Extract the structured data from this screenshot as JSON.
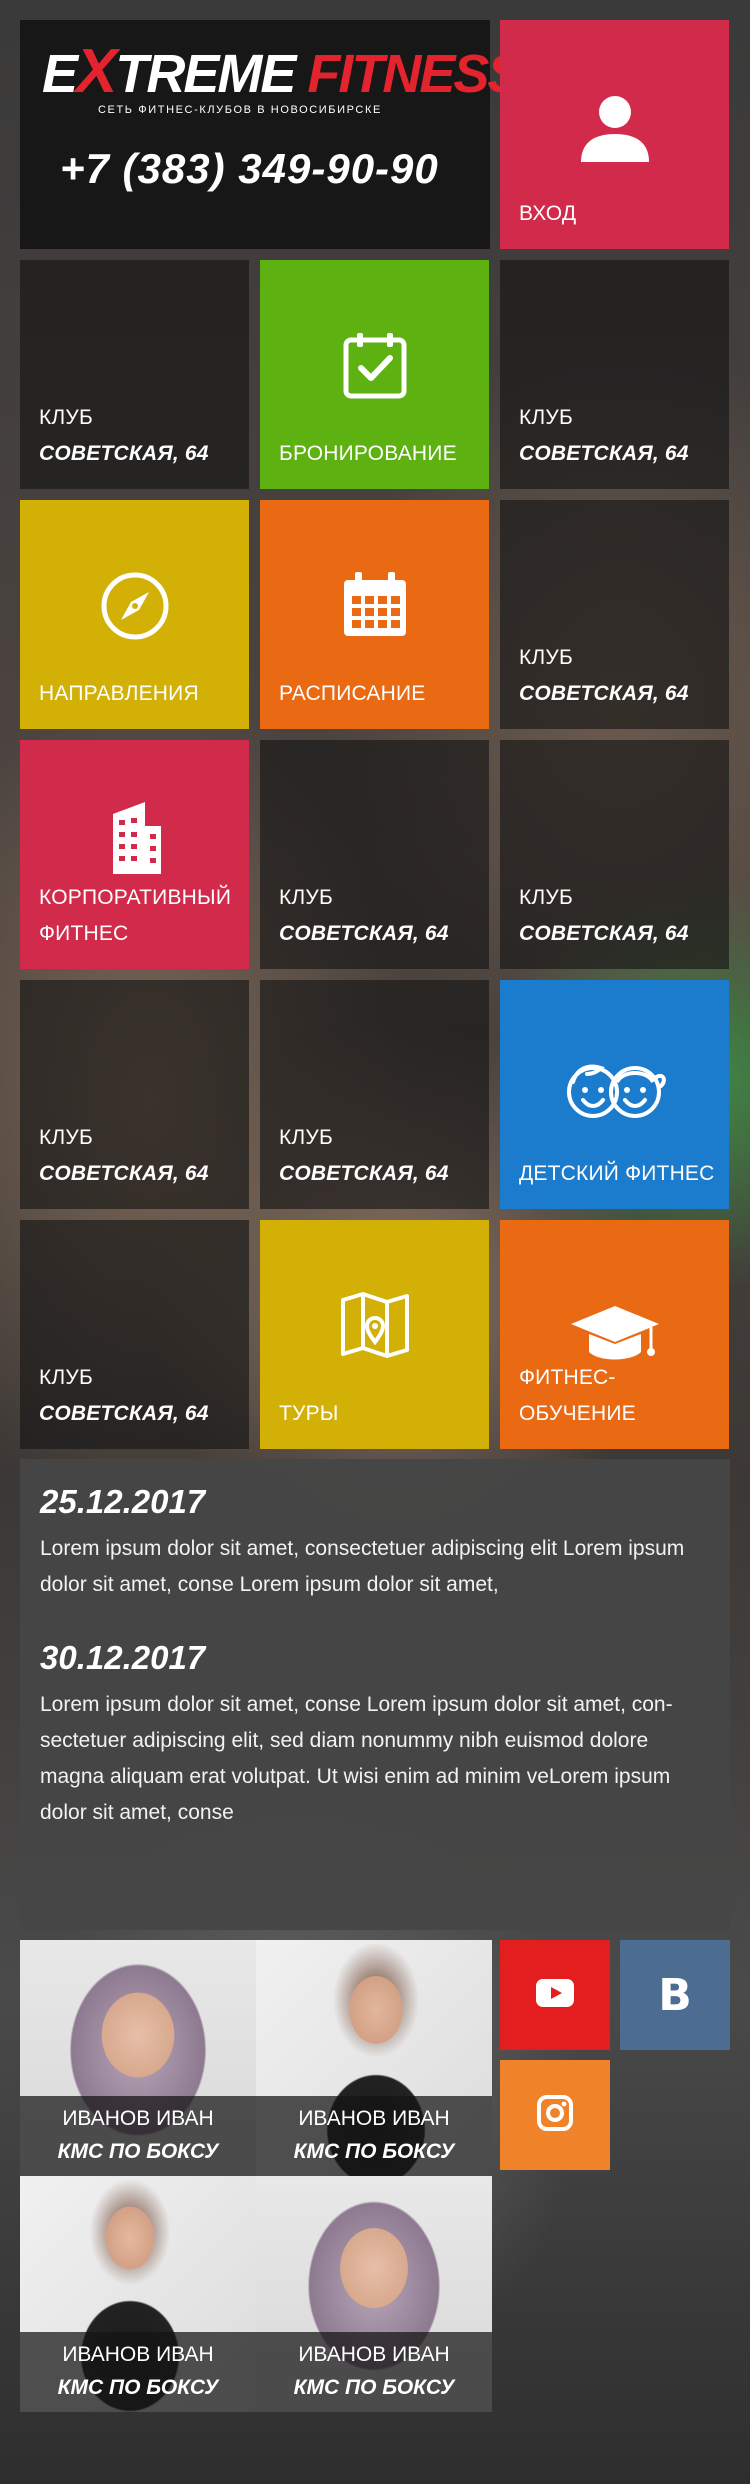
{
  "header": {
    "logo_part1": "E",
    "logo_part2": "X",
    "logo_part3": "TREME",
    "logo_part4": " FITNESS",
    "tagline": "СЕТЬ ФИТНЕС-КЛУБОВ В НОВОСИБИРСКЕ",
    "phone": "+7 (383) 349-90-90",
    "login_label": "ВХОД"
  },
  "colors": {
    "red": "#d12a4a",
    "green": "#5db111",
    "yellow": "#d2b005",
    "orange": "#ea6a14",
    "blue": "#1b7bcd",
    "logo_red": "#e3232e"
  },
  "tiles": {
    "club_title": "КЛУБ",
    "club_address": "СОВЕТСКАЯ, 64",
    "booking": "БРОНИРОВАНИЕ",
    "directions": "НАПРАВЛЕНИЯ",
    "schedule": "РАСПИСАНИЕ",
    "corporate_line1": "КОРПОРАТИВНЫЙ",
    "corporate_line2": "ФИТНЕС",
    "kids": "ДЕТСКИЙ ФИТНЕС",
    "tours": "ТУРЫ",
    "education": "ФИТНЕС-ОБУЧЕНИЕ"
  },
  "news": [
    {
      "date": "25.12.2017",
      "text": "Lorem ipsum dolor sit amet, consectetuer adipiscing elit Lorem ipsum dolor sit amet, conse Lorem ipsum dolor sit amet,"
    },
    {
      "date": "30.12.2017",
      "text": "Lorem ipsum dolor sit amet, conse Lorem ipsum dolor sit amet, con-sectetuer adipiscing elit, sed diam nonummy nibh euismod dolore magna aliquam erat volutpat. Ut wisi enim ad minim veLorem ipsum dolor sit amet, conse"
    }
  ],
  "trainers": [
    {
      "name": "ИВАНОВ ИВАН",
      "rank": "КМС ПО БОКСУ"
    },
    {
      "name": "ИВАНОВ ИВАН",
      "rank": "КМС ПО БОКСУ"
    },
    {
      "name": "ИВАНОВ ИВАН",
      "rank": "КМС ПО БОКСУ"
    },
    {
      "name": "ИВАНОВ ИВАН",
      "rank": "КМС ПО БОКСУ"
    }
  ],
  "social": {
    "youtube_icon": "youtube-icon",
    "vk_icon": "vk-icon",
    "vk_letter": "В",
    "instagram_icon": "instagram-icon",
    "youtube_color": "#e41e1e",
    "vk_color": "#4c6c91",
    "instagram_color": "#f0822a"
  }
}
